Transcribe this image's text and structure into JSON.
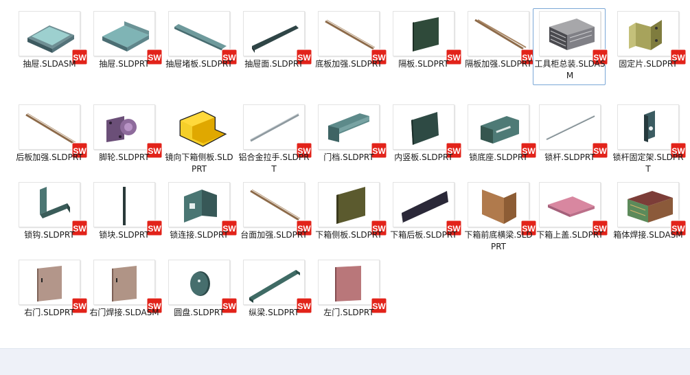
{
  "file_view": {
    "rows": [
      [
        {
          "label": "抽屉.SLDASM",
          "icon": "drawer-assembly-icon"
        },
        {
          "label": "抽屉.SLDPRT",
          "icon": "drawer-part-icon"
        },
        {
          "label": "抽屉堵板.SLDPRT",
          "icon": "drawer-plate-icon"
        },
        {
          "label": "抽屉面.SLDPRT",
          "icon": "drawer-face-icon"
        },
        {
          "label": "底板加强.SLDPRT",
          "icon": "bottom-reinforce-icon"
        },
        {
          "label": "隔板.SLDPRT",
          "icon": "partition-icon"
        },
        {
          "label": "隔板加强.SLDPRT",
          "icon": "partition-reinforce-icon"
        },
        {
          "label": "工具柜总装.SLDASM",
          "icon": "tool-cabinet-assembly-icon",
          "selected": true
        },
        {
          "label": "固定片.SLDPRT",
          "icon": "fixing-piece-icon"
        }
      ],
      [
        {
          "label": "后板加强.SLDPRT",
          "icon": "back-reinforce-icon"
        },
        {
          "label": "脚轮.SLDPRT",
          "icon": "caster-icon"
        },
        {
          "label": "镜向下箱侧板.SLDPRT",
          "icon": "mirror-side-plate-icon"
        },
        {
          "label": "铝合金拉手.SLDPRT",
          "icon": "aluminum-handle-icon"
        },
        {
          "label": "门档.SLDPRT",
          "icon": "door-stop-icon"
        },
        {
          "label": "内竖板.SLDPRT",
          "icon": "inner-vertical-plate-icon"
        },
        {
          "label": "锁底座.SLDPRT",
          "icon": "lock-base-icon"
        },
        {
          "label": "锁杆.SLDPRT",
          "icon": "lock-rod-icon"
        },
        {
          "label": "锁杆固定架.SLDPRT",
          "icon": "lock-rod-bracket-icon"
        }
      ],
      [
        {
          "label": "锁钩.SLDPRT",
          "icon": "lock-hook-icon"
        },
        {
          "label": "锁块.SLDPRT",
          "icon": "lock-block-icon"
        },
        {
          "label": "锁连接.SLDPRT",
          "icon": "lock-connector-icon"
        },
        {
          "label": "台面加强.SLDPRT",
          "icon": "table-reinforce-icon"
        },
        {
          "label": "下箱侧板.SLDPRT",
          "icon": "lower-side-plate-icon"
        },
        {
          "label": "下箱后板.SLDPRT",
          "icon": "lower-back-plate-icon"
        },
        {
          "label": "下箱前底横梁.SLDPRT",
          "icon": "lower-front-beam-icon"
        },
        {
          "label": "下箱上盖.SLDPRT",
          "icon": "lower-top-cover-icon"
        },
        {
          "label": "箱体焊接.SLDASM",
          "icon": "box-weldment-icon"
        }
      ],
      [
        {
          "label": "右门.SLDPRT",
          "icon": "right-door-icon"
        },
        {
          "label": "右门焊接.SLDASM",
          "icon": "right-door-weld-icon"
        },
        {
          "label": "圆盘.SLDPRT",
          "icon": "disc-icon"
        },
        {
          "label": "纵梁.SLDPRT",
          "icon": "longitudinal-beam-icon"
        },
        {
          "label": "左门.SLDPRT",
          "icon": "left-door-icon"
        }
      ]
    ],
    "badge": {
      "text": "SW",
      "color": "#e2231a"
    }
  }
}
